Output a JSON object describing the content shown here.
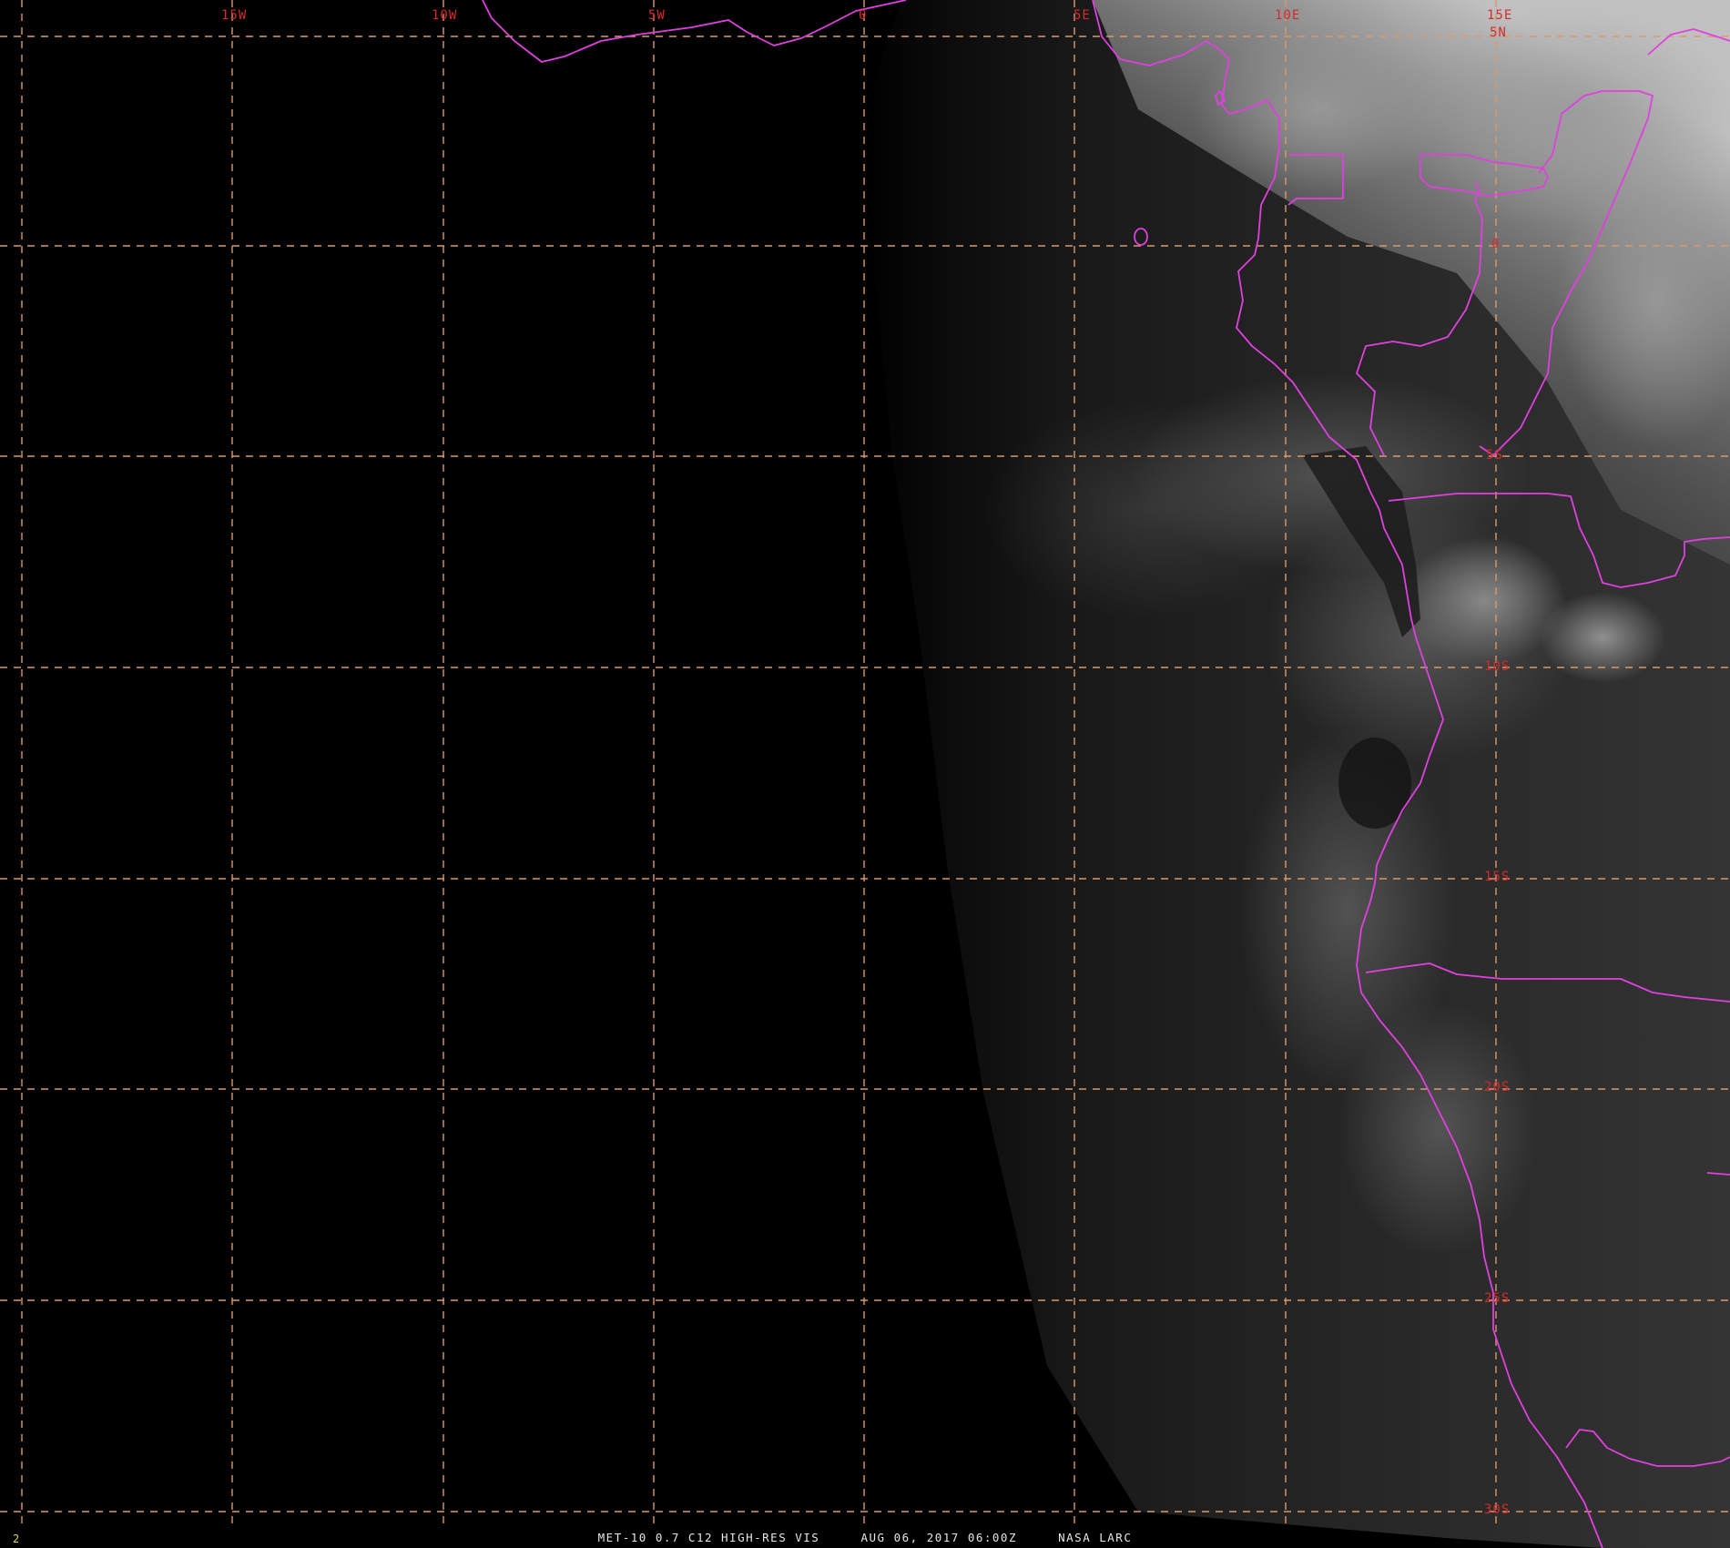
{
  "image": {
    "product_title": "MET-10 0.7 C12 HIGH-RES VIS",
    "timestamp": "AUG 06, 2017 06:00Z",
    "source": "NASA LARC",
    "frame_number": "2"
  },
  "colors": {
    "background": "#000000",
    "grid": "#d99a6c",
    "grid_label": "#d42a2a",
    "borders": "#e040e0",
    "caption": "#e6e6e6",
    "frame_number": "#e6d63a"
  },
  "map": {
    "projection": "satellite visible imagery",
    "longitude_range": [
      -20,
      20
    ],
    "latitude_range": [
      -30,
      6
    ],
    "grid_interval_degrees": 5,
    "longitude_labels": [
      "15W",
      "10W",
      "5W",
      "0",
      "5E",
      "10E",
      "15E"
    ],
    "latitude_labels": [
      "5N",
      "0",
      "5S",
      "10S",
      "15S",
      "20S",
      "25S",
      "30S"
    ]
  }
}
